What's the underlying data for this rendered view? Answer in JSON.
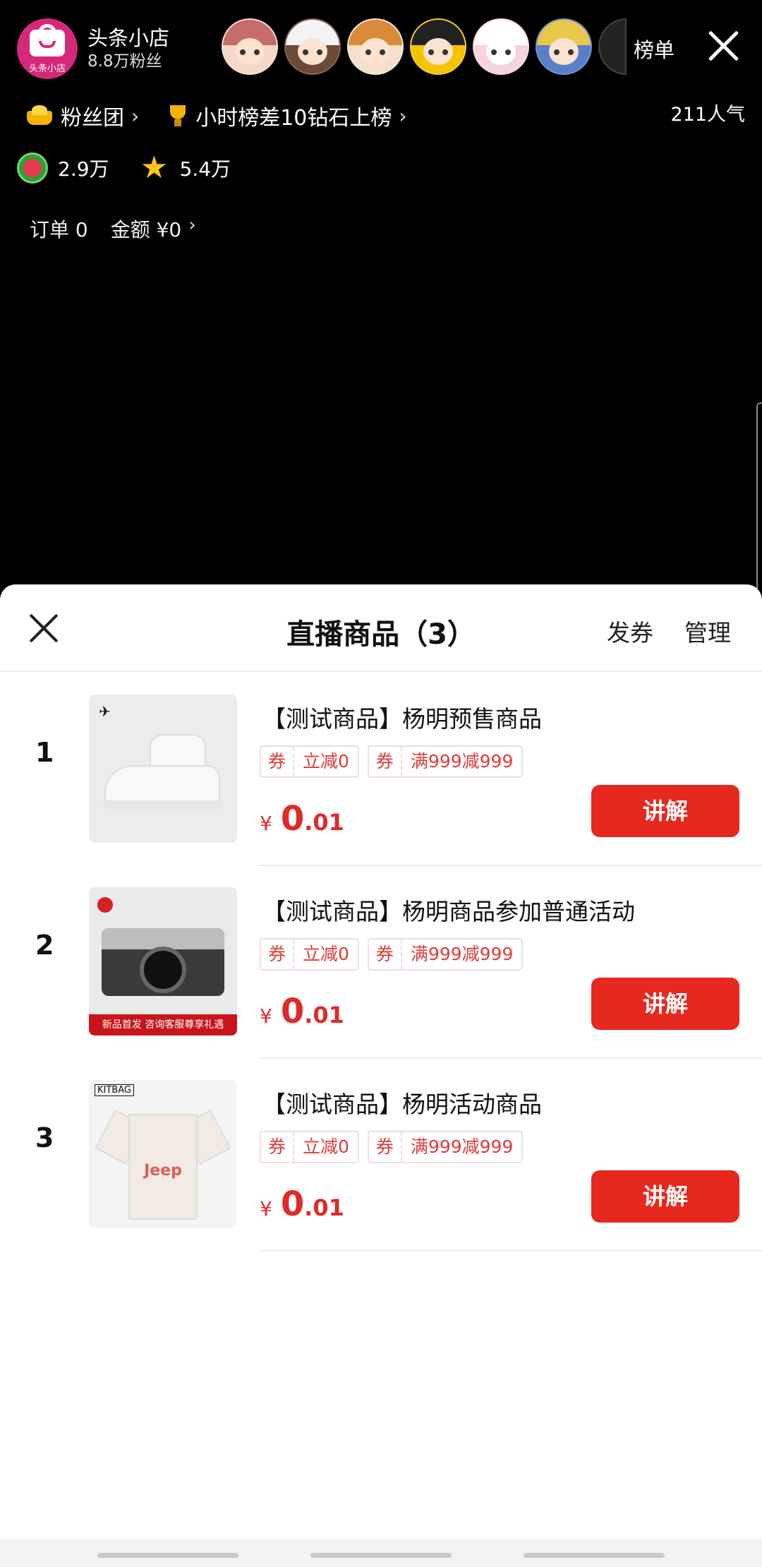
{
  "live": {
    "host": {
      "name": "头条小店",
      "fans": "8.8万粉丝",
      "logo_text": "头条小店"
    },
    "rank_label": "榜单",
    "fan_club": "粉丝团",
    "hour_rank": "小时榜差10钻石上榜",
    "popularity": "211人气",
    "gifts": [
      {
        "icon": "watermelon-icon",
        "count": "2.9万"
      },
      {
        "icon": "star-icon",
        "count": "5.4万"
      }
    ],
    "order_label": "订单 0",
    "amount_label": "金额 ¥0"
  },
  "sheet": {
    "title": "直播商品（3）",
    "coupon_label": "发券",
    "manage_label": "管理"
  },
  "products": [
    {
      "index": "1",
      "title": "【测试商品】杨明预售商品",
      "tags": [
        {
          "prefix": "券",
          "text": "立减0"
        },
        {
          "prefix": "券",
          "text": "满999减999"
        }
      ],
      "currency": "¥",
      "price_int": "0",
      "price_dec": ".01",
      "button": "讲解",
      "image": "sneaker"
    },
    {
      "index": "2",
      "title": "【测试商品】杨明商品参加普通活动",
      "tags": [
        {
          "prefix": "券",
          "text": "立减0"
        },
        {
          "prefix": "券",
          "text": "满999减999"
        }
      ],
      "currency": "¥",
      "price_int": "0",
      "price_dec": ".01",
      "button": "讲解",
      "image": "camera",
      "image_caption": "新品首发   咨询客服尊享礼遇"
    },
    {
      "index": "3",
      "title": "【测试商品】杨明活动商品",
      "tags": [
        {
          "prefix": "券",
          "text": "立减0"
        },
        {
          "prefix": "券",
          "text": "满999减999"
        }
      ],
      "currency": "¥",
      "price_int": "0",
      "price_dec": ".01",
      "button": "讲解",
      "image": "jersey",
      "image_brand": "KITBAG",
      "image_logo": "Jeep"
    }
  ],
  "colors": {
    "accent_red": "#e6281f",
    "price_red": "#e02a2a",
    "host_pink": "#d6287a"
  }
}
